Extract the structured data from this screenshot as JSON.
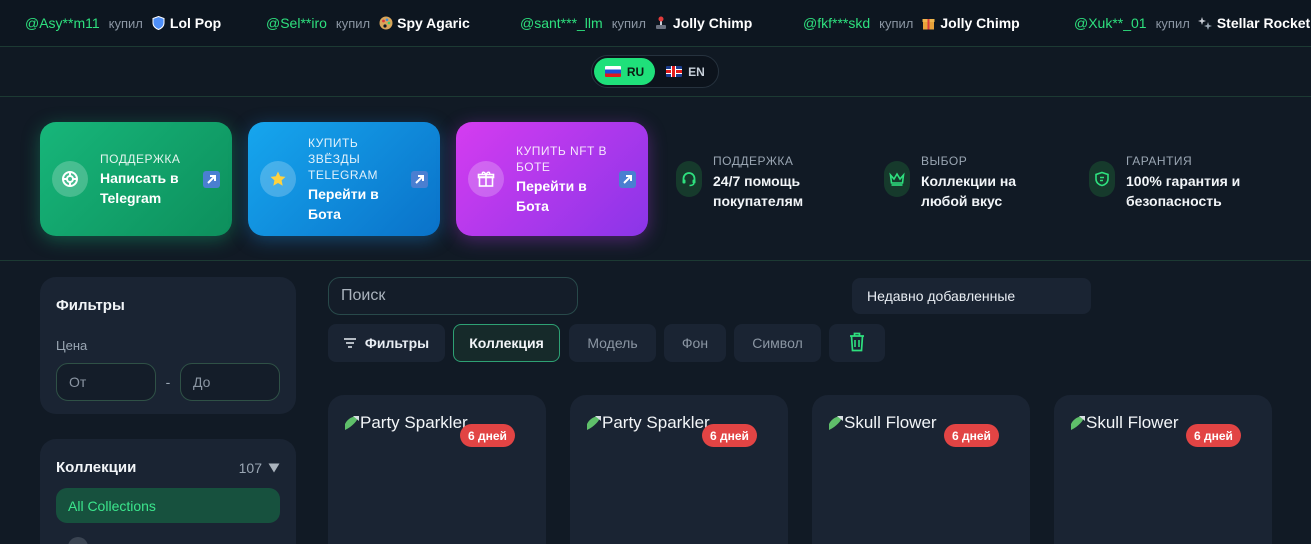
{
  "ticker": [
    {
      "user": "@Asy**m11",
      "verb": "купил",
      "icon": "shield-icon",
      "gift": "Lol Pop"
    },
    {
      "user": "@Sel**iro",
      "verb": "купил",
      "icon": "palette-icon",
      "gift": "Spy Agaric"
    },
    {
      "user": "@sant***_llm",
      "verb": "купил",
      "icon": "joystick-icon",
      "gift": "Jolly Chimp"
    },
    {
      "user": "@fkf***skd",
      "verb": "купил",
      "icon": "gift-box-icon",
      "gift": "Jolly Chimp"
    },
    {
      "user": "@Xuk**_01",
      "verb": "купил",
      "icon": "sparkle-icon",
      "gift": "Stellar Rocket"
    }
  ],
  "language": {
    "ru": "RU",
    "en": "EN",
    "active": "ru"
  },
  "hero": {
    "cards": [
      {
        "kicker": "ПОДДЕРЖКА",
        "title": "Написать в Telegram"
      },
      {
        "kicker": "КУПИТЬ ЗВЁЗДЫ TELEGRAM",
        "title": "Перейти в Бота"
      },
      {
        "kicker": "КУПИТЬ NFT В БОТЕ",
        "title": "Перейти в Бота"
      }
    ],
    "features": [
      {
        "kicker": "ПОДДЕРЖКА",
        "title": "24/7 помощь покупателям"
      },
      {
        "kicker": "ВЫБОР",
        "title": "Коллекции на любой вкус"
      },
      {
        "kicker": "ГАРАНТИЯ",
        "title": "100% гарантия и безопасность"
      }
    ]
  },
  "sidebar": {
    "filters_title": "Фильтры",
    "price_label": "Цена",
    "price_from_placeholder": "От",
    "price_dash": "-",
    "price_to_placeholder": "До",
    "collections_title": "Коллекции",
    "collections_count": "107",
    "collection_selected": "All Collections"
  },
  "toolbar": {
    "search_placeholder": "Поиск",
    "sort_label": "Недавно добавленные",
    "filters_button": "Фильтры",
    "chips": [
      "Коллекция",
      "Модель",
      "Фон",
      "Символ"
    ]
  },
  "products": [
    {
      "name": "Party Sparkler",
      "badge": "6 дней"
    },
    {
      "name": "Party Sparkler",
      "badge": "6 дней"
    },
    {
      "name": "Skull Flower",
      "badge": "6 дней"
    },
    {
      "name": "Skull Flower",
      "badge": "6 дней"
    }
  ],
  "colors": {
    "accent": "#1fe07a",
    "ticker_user": "#2ee07e",
    "badge": "#e24444"
  }
}
